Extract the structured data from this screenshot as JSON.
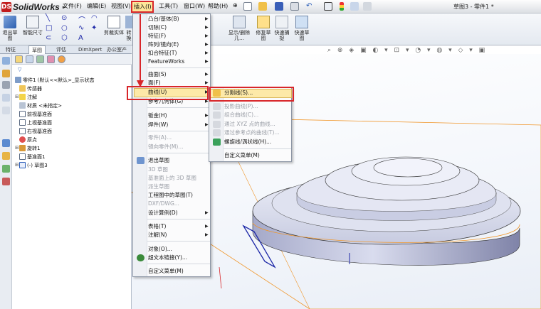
{
  "app": {
    "name": "SolidWorks",
    "logo": "DS"
  },
  "document_title": "草图3 - 零件1 *",
  "menubar": [
    {
      "label": "文件(F)",
      "active": false
    },
    {
      "label": "编辑(E)",
      "active": false
    },
    {
      "label": "视图(V)",
      "active": false
    },
    {
      "label": "插入(I)",
      "active": true
    },
    {
      "label": "工具(T)",
      "active": false
    },
    {
      "label": "窗口(W)",
      "active": false
    },
    {
      "label": "帮助(H)",
      "active": false
    }
  ],
  "ribbon": {
    "exit_sketch": "退出草图",
    "smart_dim": "智能尺寸",
    "cut_entities": "剪裁实体",
    "convert": "转换",
    "show_delete": "显示/删除几…",
    "repair_sketch": "修复草图",
    "quick_snaps": "快速捕捉",
    "fast_sketch": "快速草图"
  },
  "tabs": [
    {
      "label": "特征",
      "active": false
    },
    {
      "label": "草图",
      "active": true
    },
    {
      "label": "评估",
      "active": false
    },
    {
      "label": "DimXpert",
      "active": false
    },
    {
      "label": "办公室产品",
      "active": false
    }
  ],
  "feature_tree": {
    "root": "零件1 (默认<<默认>_显示状态",
    "items": [
      {
        "label": "传感器",
        "icon": "sensor-icon"
      },
      {
        "label": "注解",
        "icon": "annotation-icon"
      },
      {
        "label": "材质 <未指定>",
        "icon": "material-icon"
      },
      {
        "label": "前视基准面",
        "icon": "plane-icon"
      },
      {
        "label": "上视基准面",
        "icon": "plane-icon"
      },
      {
        "label": "右视基准面",
        "icon": "plane-icon"
      },
      {
        "label": "原点",
        "icon": "origin-icon"
      },
      {
        "label": "旋转1",
        "icon": "revolve-icon"
      },
      {
        "label": "基准面1",
        "icon": "plane-icon"
      },
      {
        "label": "(-) 草图3",
        "icon": "sketch-icon"
      }
    ]
  },
  "insert_menu": [
    {
      "label": "凸台/基体(B)",
      "arrow": true,
      "enabled": true
    },
    {
      "label": "切除(C)",
      "arrow": true,
      "enabled": true
    },
    {
      "label": "特征(F)",
      "arrow": true,
      "enabled": true
    },
    {
      "label": "阵列/镜向(E)",
      "arrow": true,
      "enabled": true
    },
    {
      "label": "扣合特征(T)",
      "arrow": true,
      "enabled": true
    },
    {
      "label": "FeatureWorks",
      "arrow": true,
      "enabled": true
    },
    {
      "label": "曲面(S)",
      "arrow": true,
      "enabled": true
    },
    {
      "label": "面(F)",
      "arrow": true,
      "enabled": true
    },
    {
      "label": "曲线(U)",
      "arrow": true,
      "enabled": true,
      "highlighted": true
    },
    {
      "label": "参考几何体(G)",
      "arrow": true,
      "enabled": true
    },
    {
      "label": "钣金(H)",
      "arrow": true,
      "enabled": true
    },
    {
      "label": "焊件(W)",
      "arrow": true,
      "enabled": true
    },
    {
      "label": "零件(A)...",
      "arrow": false,
      "enabled": false
    },
    {
      "label": "镜向零件(M)...",
      "arrow": false,
      "enabled": false
    },
    {
      "label": "退出草图",
      "arrow": false,
      "enabled": true
    },
    {
      "label": "3D 草图",
      "arrow": false,
      "enabled": false
    },
    {
      "label": "基准面上的 3D 草图",
      "arrow": false,
      "enabled": false
    },
    {
      "label": "派生草图",
      "arrow": false,
      "enabled": false
    },
    {
      "label": "工程图中的草图(T)",
      "arrow": false,
      "enabled": true
    },
    {
      "label": "DXF/DWG...",
      "arrow": false,
      "enabled": false
    },
    {
      "label": "设计算例(D)",
      "arrow": true,
      "enabled": true
    },
    {
      "label": "表格(T)",
      "arrow": true,
      "enabled": true
    },
    {
      "label": "注解(N)",
      "arrow": true,
      "enabled": true
    },
    {
      "label": "对象(O)...",
      "arrow": false,
      "enabled": true
    },
    {
      "label": "超文本链接(Y)...",
      "arrow": false,
      "enabled": true
    },
    {
      "label": "自定义菜单(M)",
      "arrow": false,
      "enabled": true
    }
  ],
  "curve_submenu": [
    {
      "label": "分割线(S)...",
      "enabled": true,
      "highlighted": true
    },
    {
      "label": "投影曲线(P)...",
      "enabled": false
    },
    {
      "label": "组合曲线(C)...",
      "enabled": false
    },
    {
      "label": "通过 XYZ 点的曲线...",
      "enabled": false
    },
    {
      "label": "通过参考点的曲线(T)...",
      "enabled": false
    },
    {
      "label": "螺旋线/涡状线(H)...",
      "enabled": true
    },
    {
      "label": "自定义菜单(M)",
      "enabled": true
    }
  ],
  "colors": {
    "accent_red": "#d8262a",
    "highlight": "#fde9a8",
    "sketch_blue": "#1f2aa8",
    "sketch_orange": "#f0962a"
  }
}
